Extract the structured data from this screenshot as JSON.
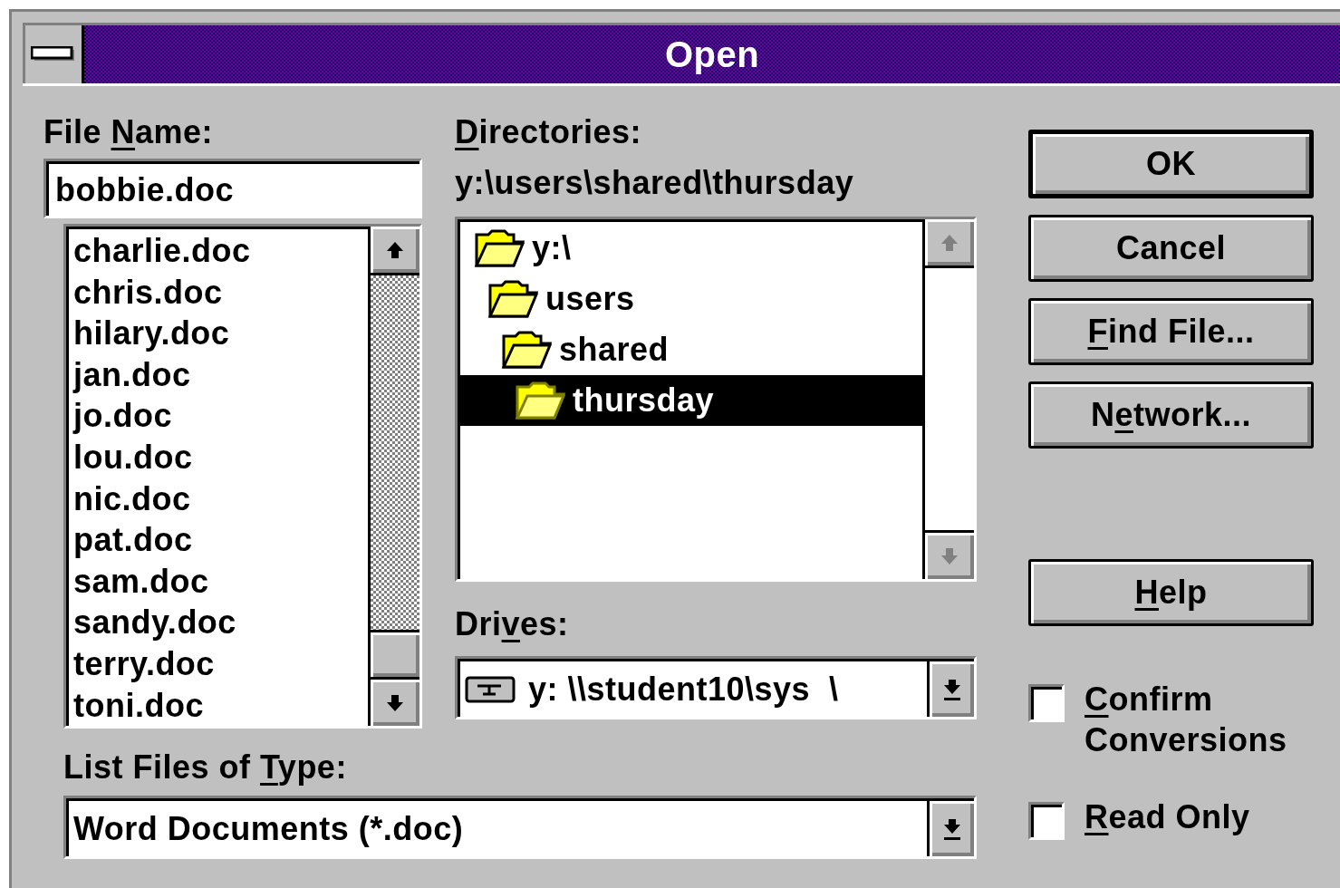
{
  "window": {
    "title": "Open"
  },
  "file_name": {
    "label": {
      "pre": "File ",
      "key": "N",
      "post": "ame:"
    },
    "value": "bobbie.doc",
    "files": [
      {
        "name": "charlie.doc",
        "selected": false
      },
      {
        "name": "chris.doc",
        "selected": false
      },
      {
        "name": "hilary.doc",
        "selected": false
      },
      {
        "name": "jan.doc",
        "selected": false
      },
      {
        "name": "jo.doc",
        "selected": false
      },
      {
        "name": "lou.doc",
        "selected": false
      },
      {
        "name": "nic.doc",
        "selected": false
      },
      {
        "name": "pat.doc",
        "selected": false
      },
      {
        "name": "sam.doc",
        "selected": false
      },
      {
        "name": "sandy.doc",
        "selected": false
      },
      {
        "name": "terry.doc",
        "selected": false
      },
      {
        "name": "toni.doc",
        "selected": false
      }
    ]
  },
  "directories": {
    "label": {
      "key": "D",
      "post": "irectories:"
    },
    "path": "y:\\users\\shared\\thursday",
    "tree": [
      {
        "name": "y:\\",
        "selected": false,
        "children": [
          {
            "name": "users",
            "selected": false,
            "children": [
              {
                "name": "shared",
                "selected": false,
                "children": [
                  {
                    "name": "thursday",
                    "selected": true
                  }
                ]
              }
            ]
          }
        ]
      }
    ]
  },
  "drives": {
    "label": {
      "pre": "Dri",
      "key": "v",
      "post": "es:"
    },
    "value": "y: \\\\student10\\sys  \\"
  },
  "file_type": {
    "label": {
      "pre": "List Files of ",
      "key": "T",
      "post": "ype:"
    },
    "value": "Word Documents (*.doc)"
  },
  "buttons": [
    {
      "label": {
        "pre": "OK"
      },
      "default": true
    },
    {
      "label": {
        "pre": "Cancel"
      },
      "default": false
    },
    {
      "label": {
        "key": "F",
        "post": "ind File..."
      },
      "default": false
    },
    {
      "label": {
        "pre": "N",
        "key": "e",
        "post": "twork..."
      },
      "default": false
    },
    {
      "label": {
        "key": "H",
        "post": "elp"
      },
      "default": false
    }
  ],
  "options": [
    {
      "label": {
        "key": "C",
        "post": "onfirm Conversions"
      },
      "checked": false
    },
    {
      "label": {
        "key": "R",
        "post": "ead Only"
      },
      "checked": false
    }
  ]
}
